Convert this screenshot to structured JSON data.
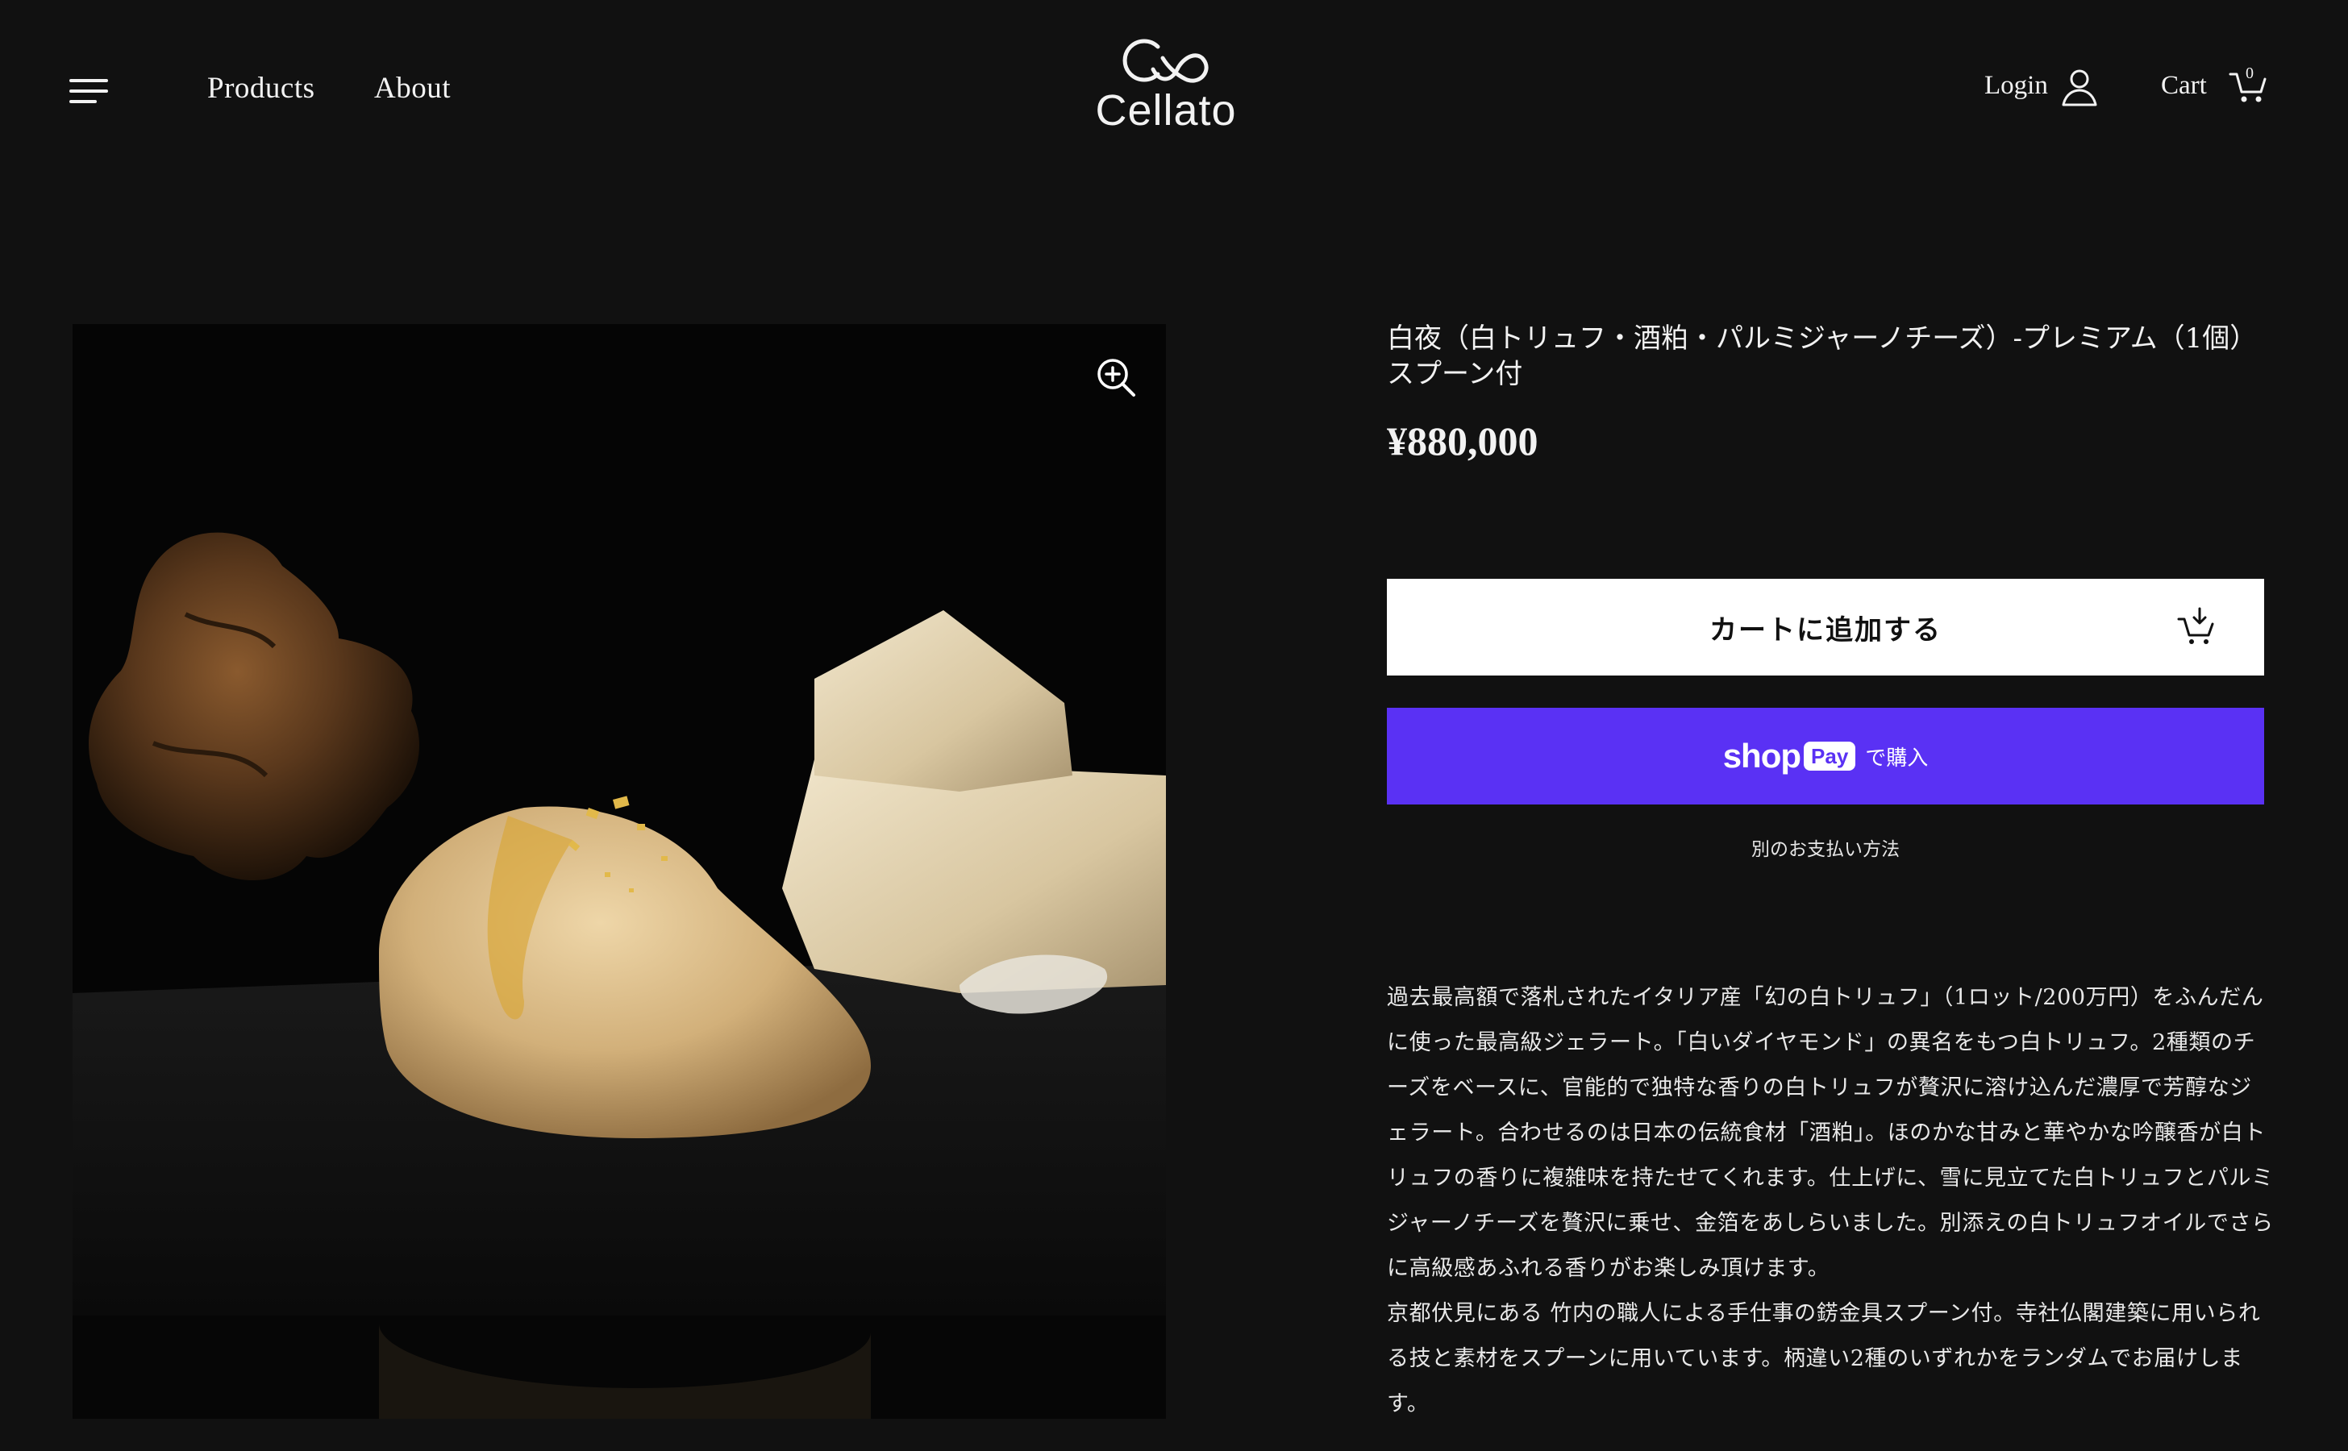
{
  "header": {
    "nav": {
      "products_label": "Products",
      "about_label": "About"
    },
    "logo_text": "Cellato",
    "login_label": "Login",
    "cart_label": "Cart",
    "cart_count": "0"
  },
  "product": {
    "title": "白夜（白トリュフ・酒粕・パルミジャーノチーズ）-プレミアム（1個）スプーン付",
    "price": "¥880,000",
    "add_to_cart_label": "カートに追加する",
    "shop_pay": {
      "shop_label": "shop",
      "pay_label": "Pay",
      "buy_label": "で購入"
    },
    "other_payment_label": "別のお支払い方法",
    "description": [
      "過去最高額で落札されたイタリア産「幻の白トリュフ」（1ロット/200万円）をふんだんに使った最高級ジェラート。「白いダイヤモンド」の異名をもつ白トリュフ。2種類のチーズをベースに、官能的で独特な香りの白トリュフが贅沢に溶け込んだ濃厚で芳醇なジェラート。合わせるのは日本の伝統食材「酒粕」。ほのかな甘みと華やかな吟醸香が白トリュフの香りに複雑味を持たせてくれます。仕上げに、雪に見立てた白トリュフとパルミジャーノチーズを贅沢に乗せ、金箔をあしらいました。別添えの白トリュフオイルでさらに高級感あふれる香りがお楽しみ頂けます。",
      "京都伏見にある 竹内の職人による手仕事の錺金具スプーン付。寺社仏閣建築に用いられる技と素材をスプーンに用いています。柄違い2種のいずれかをランダムでお届けします。"
    ]
  },
  "colors": {
    "background": "#111111",
    "text": "#f2f2f2",
    "shop_pay_purple": "#5a31f4",
    "add_to_cart_bg": "#ffffff"
  },
  "icons": {
    "menu": "hamburger-menu-icon",
    "logo": "cellato-logo-mark",
    "login": "user-icon",
    "cart": "cart-icon",
    "zoom": "zoom-in-icon",
    "add_to_cart": "cart-add-icon"
  }
}
